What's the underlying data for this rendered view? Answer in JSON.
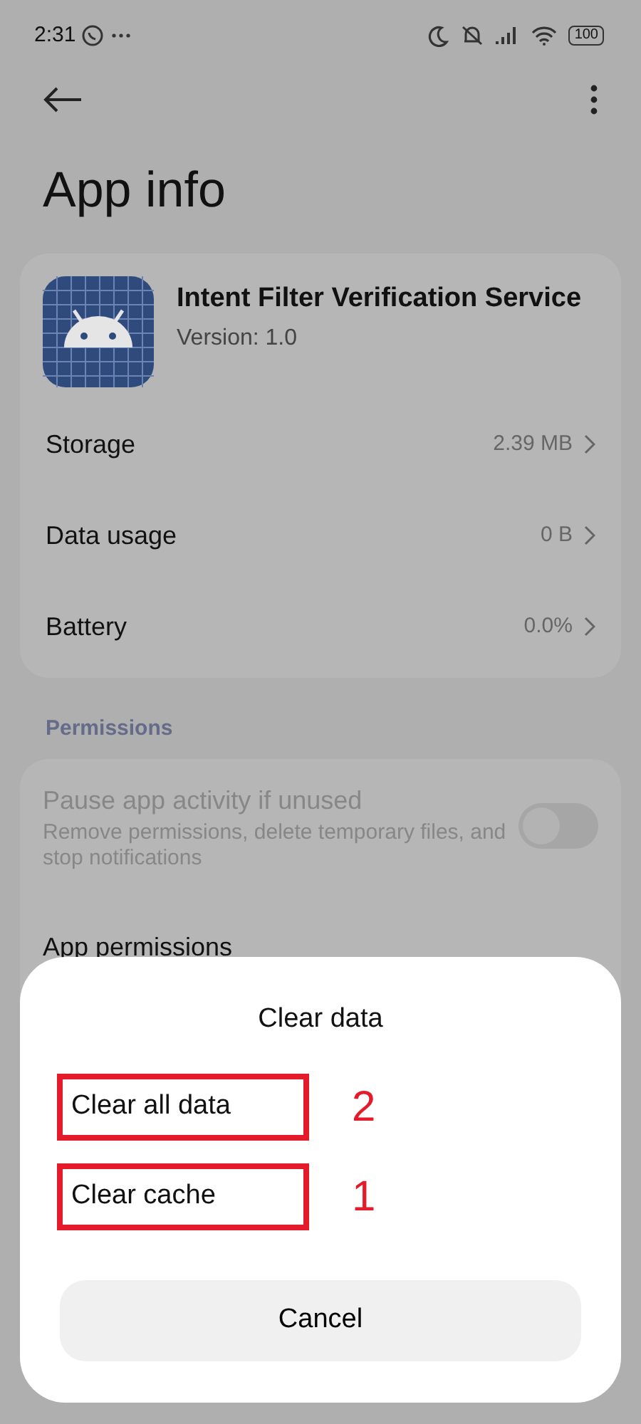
{
  "status_bar": {
    "time": "2:31",
    "battery": "100"
  },
  "title": "App info",
  "app": {
    "name": "Intent Filter Verification Service",
    "version": "Version: 1.0"
  },
  "info_rows": [
    {
      "label": "Storage",
      "value": "2.39 MB"
    },
    {
      "label": "Data usage",
      "value": "0 B"
    },
    {
      "label": "Battery",
      "value": "0.0%"
    }
  ],
  "permissions": {
    "header": "Permissions",
    "items": [
      {
        "kind": "toggle",
        "title": "Pause app activity if unused",
        "subtitle": "Remove permissions, delete temporary files, and stop notifications",
        "disabled": true,
        "on": false
      },
      {
        "kind": "link",
        "title": "App permissions",
        "disabled": false
      }
    ]
  },
  "dialog": {
    "title": "Clear data",
    "options": [
      {
        "label": "Clear all data",
        "highlighted": true,
        "annotation": "2"
      },
      {
        "label": "Clear cache",
        "highlighted": true,
        "annotation": "1"
      }
    ],
    "cancel": "Cancel"
  }
}
